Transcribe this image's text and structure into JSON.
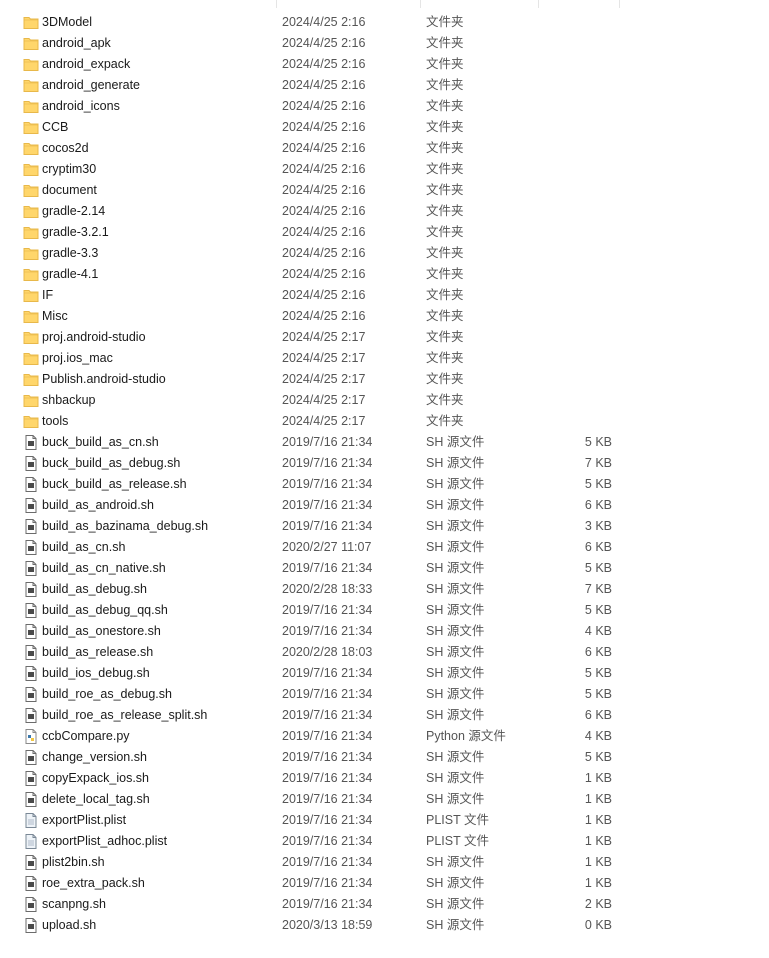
{
  "files": [
    {
      "name": "3DModel",
      "date": "2024/4/25 2:16",
      "type": "文件夹",
      "size": "",
      "icon": "folder-icon"
    },
    {
      "name": "android_apk",
      "date": "2024/4/25 2:16",
      "type": "文件夹",
      "size": "",
      "icon": "folder-icon"
    },
    {
      "name": "android_expack",
      "date": "2024/4/25 2:16",
      "type": "文件夹",
      "size": "",
      "icon": "folder-icon"
    },
    {
      "name": "android_generate",
      "date": "2024/4/25 2:16",
      "type": "文件夹",
      "size": "",
      "icon": "folder-icon"
    },
    {
      "name": "android_icons",
      "date": "2024/4/25 2:16",
      "type": "文件夹",
      "size": "",
      "icon": "folder-icon"
    },
    {
      "name": "CCB",
      "date": "2024/4/25 2:16",
      "type": "文件夹",
      "size": "",
      "icon": "folder-icon"
    },
    {
      "name": "cocos2d",
      "date": "2024/4/25 2:16",
      "type": "文件夹",
      "size": "",
      "icon": "folder-icon"
    },
    {
      "name": "cryptim30",
      "date": "2024/4/25 2:16",
      "type": "文件夹",
      "size": "",
      "icon": "folder-icon"
    },
    {
      "name": "document",
      "date": "2024/4/25 2:16",
      "type": "文件夹",
      "size": "",
      "icon": "folder-icon"
    },
    {
      "name": "gradle-2.14",
      "date": "2024/4/25 2:16",
      "type": "文件夹",
      "size": "",
      "icon": "folder-icon"
    },
    {
      "name": "gradle-3.2.1",
      "date": "2024/4/25 2:16",
      "type": "文件夹",
      "size": "",
      "icon": "folder-icon"
    },
    {
      "name": "gradle-3.3",
      "date": "2024/4/25 2:16",
      "type": "文件夹",
      "size": "",
      "icon": "folder-icon"
    },
    {
      "name": "gradle-4.1",
      "date": "2024/4/25 2:16",
      "type": "文件夹",
      "size": "",
      "icon": "folder-icon"
    },
    {
      "name": "IF",
      "date": "2024/4/25 2:16",
      "type": "文件夹",
      "size": "",
      "icon": "folder-icon"
    },
    {
      "name": "Misc",
      "date": "2024/4/25 2:16",
      "type": "文件夹",
      "size": "",
      "icon": "folder-icon"
    },
    {
      "name": "proj.android-studio",
      "date": "2024/4/25 2:17",
      "type": "文件夹",
      "size": "",
      "icon": "folder-icon"
    },
    {
      "name": "proj.ios_mac",
      "date": "2024/4/25 2:17",
      "type": "文件夹",
      "size": "",
      "icon": "folder-icon"
    },
    {
      "name": "Publish.android-studio",
      "date": "2024/4/25 2:17",
      "type": "文件夹",
      "size": "",
      "icon": "folder-icon"
    },
    {
      "name": "shbackup",
      "date": "2024/4/25 2:17",
      "type": "文件夹",
      "size": "",
      "icon": "folder-icon"
    },
    {
      "name": "tools",
      "date": "2024/4/25 2:17",
      "type": "文件夹",
      "size": "",
      "icon": "folder-icon"
    },
    {
      "name": "buck_build_as_cn.sh",
      "date": "2019/7/16 21:34",
      "type": "SH 源文件",
      "size": "5 KB",
      "icon": "shell-file-icon"
    },
    {
      "name": "buck_build_as_debug.sh",
      "date": "2019/7/16 21:34",
      "type": "SH 源文件",
      "size": "7 KB",
      "icon": "shell-file-icon"
    },
    {
      "name": "buck_build_as_release.sh",
      "date": "2019/7/16 21:34",
      "type": "SH 源文件",
      "size": "5 KB",
      "icon": "shell-file-icon"
    },
    {
      "name": "build_as_android.sh",
      "date": "2019/7/16 21:34",
      "type": "SH 源文件",
      "size": "6 KB",
      "icon": "shell-file-icon"
    },
    {
      "name": "build_as_bazinama_debug.sh",
      "date": "2019/7/16 21:34",
      "type": "SH 源文件",
      "size": "3 KB",
      "icon": "shell-file-icon"
    },
    {
      "name": "build_as_cn.sh",
      "date": "2020/2/27 11:07",
      "type": "SH 源文件",
      "size": "6 KB",
      "icon": "shell-file-icon"
    },
    {
      "name": "build_as_cn_native.sh",
      "date": "2019/7/16 21:34",
      "type": "SH 源文件",
      "size": "5 KB",
      "icon": "shell-file-icon"
    },
    {
      "name": "build_as_debug.sh",
      "date": "2020/2/28 18:33",
      "type": "SH 源文件",
      "size": "7 KB",
      "icon": "shell-file-icon"
    },
    {
      "name": "build_as_debug_qq.sh",
      "date": "2019/7/16 21:34",
      "type": "SH 源文件",
      "size": "5 KB",
      "icon": "shell-file-icon"
    },
    {
      "name": "build_as_onestore.sh",
      "date": "2019/7/16 21:34",
      "type": "SH 源文件",
      "size": "4 KB",
      "icon": "shell-file-icon"
    },
    {
      "name": "build_as_release.sh",
      "date": "2020/2/28 18:03",
      "type": "SH 源文件",
      "size": "6 KB",
      "icon": "shell-file-icon"
    },
    {
      "name": "build_ios_debug.sh",
      "date": "2019/7/16 21:34",
      "type": "SH 源文件",
      "size": "5 KB",
      "icon": "shell-file-icon"
    },
    {
      "name": "build_roe_as_debug.sh",
      "date": "2019/7/16 21:34",
      "type": "SH 源文件",
      "size": "5 KB",
      "icon": "shell-file-icon"
    },
    {
      "name": "build_roe_as_release_split.sh",
      "date": "2019/7/16 21:34",
      "type": "SH 源文件",
      "size": "6 KB",
      "icon": "shell-file-icon"
    },
    {
      "name": "ccbCompare.py",
      "date": "2019/7/16 21:34",
      "type": "Python 源文件",
      "size": "4 KB",
      "icon": "python-file-icon"
    },
    {
      "name": "change_version.sh",
      "date": "2019/7/16 21:34",
      "type": "SH 源文件",
      "size": "5 KB",
      "icon": "shell-file-icon"
    },
    {
      "name": "copyExpack_ios.sh",
      "date": "2019/7/16 21:34",
      "type": "SH 源文件",
      "size": "1 KB",
      "icon": "shell-file-icon"
    },
    {
      "name": "delete_local_tag.sh",
      "date": "2019/7/16 21:34",
      "type": "SH 源文件",
      "size": "1 KB",
      "icon": "shell-file-icon"
    },
    {
      "name": "exportPlist.plist",
      "date": "2019/7/16 21:34",
      "type": "PLIST 文件",
      "size": "1 KB",
      "icon": "plist-file-icon"
    },
    {
      "name": "exportPlist_adhoc.plist",
      "date": "2019/7/16 21:34",
      "type": "PLIST 文件",
      "size": "1 KB",
      "icon": "plist-file-icon"
    },
    {
      "name": "plist2bin.sh",
      "date": "2019/7/16 21:34",
      "type": "SH 源文件",
      "size": "1 KB",
      "icon": "shell-file-icon"
    },
    {
      "name": "roe_extra_pack.sh",
      "date": "2019/7/16 21:34",
      "type": "SH 源文件",
      "size": "1 KB",
      "icon": "shell-file-icon"
    },
    {
      "name": "scanpng.sh",
      "date": "2019/7/16 21:34",
      "type": "SH 源文件",
      "size": "2 KB",
      "icon": "shell-file-icon"
    },
    {
      "name": "upload.sh",
      "date": "2020/3/13 18:59",
      "type": "SH 源文件",
      "size": "0 KB",
      "icon": "shell-file-icon"
    }
  ],
  "colors": {
    "folder": "#ffd66b",
    "folder_dark": "#e8b84a",
    "text": "#1a1a1a",
    "secondary_text": "#555555"
  }
}
